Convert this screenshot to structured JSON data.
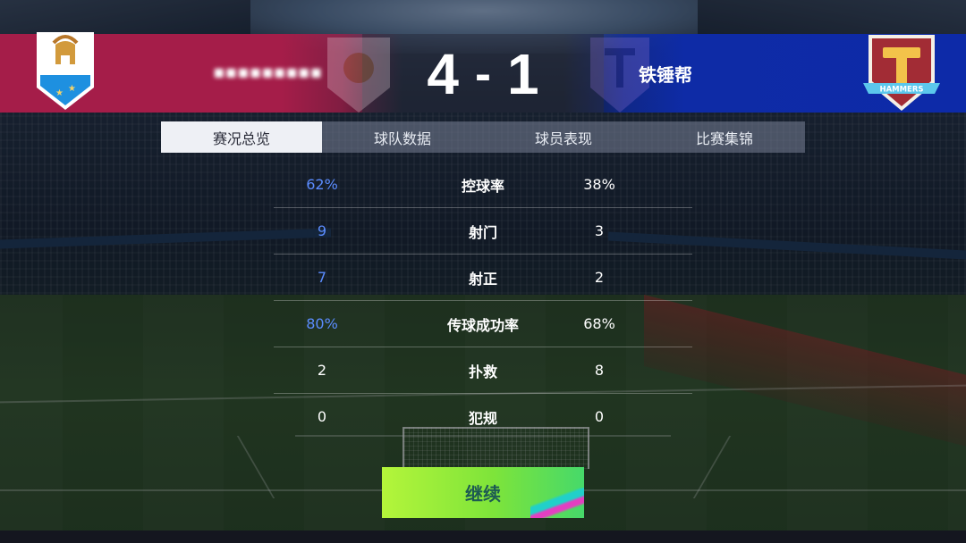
{
  "match": {
    "home_team_name": "▪▪▪▪▪▪▪▪▪",
    "away_team_name": "铁锤帮",
    "home_score": "4",
    "away_score": "1",
    "separator": "-",
    "away_crest_text": "HAMMERS"
  },
  "tabs": [
    {
      "label": "赛况总览",
      "active": true
    },
    {
      "label": "球队数据",
      "active": false
    },
    {
      "label": "球员表现",
      "active": false
    },
    {
      "label": "比赛集锦",
      "active": false
    }
  ],
  "stats": [
    {
      "label": "控球率",
      "home": "62%",
      "away": "38%"
    },
    {
      "label": "射门",
      "home": "9",
      "away": "3"
    },
    {
      "label": "射正",
      "home": "7",
      "away": "2"
    },
    {
      "label": "传球成功率",
      "home": "80%",
      "away": "68%"
    },
    {
      "label": "扑救",
      "home": "2",
      "away": "8"
    },
    {
      "label": "犯规",
      "home": "0",
      "away": "0"
    }
  ],
  "continue_button": {
    "label": "继续"
  },
  "colors": {
    "home_band": "#a51d49",
    "away_band": "#0d2aa8",
    "highlight_blue": "#5b8cff",
    "highlight_red": "#ff3e64",
    "continue_green": "#7ee43a"
  },
  "icons": {
    "home_crest": "spartan-helmet-crest-icon",
    "away_crest": "hammers-crest-icon"
  }
}
